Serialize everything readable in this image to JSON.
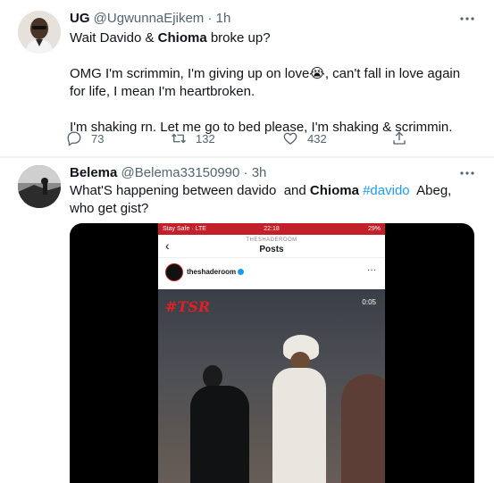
{
  "tweets": [
    {
      "name": "UG",
      "handle": "@UgwunnaEjikem",
      "separator": "·",
      "time": "1h",
      "body": {
        "line1_pre": "Wait Davido & ",
        "line1_bold": "Chioma",
        "line1_post": " broke up?",
        "para2": "OMG I'm scrimmin, I'm giving up on love😭, can't fall in love again for life, I mean I'm heartbroken.",
        "para3": "I'm shaking rn. Let me go to bed please, I'm shaking & scrimmin."
      },
      "actions": {
        "reply_count": "73",
        "retweet_count": "132",
        "like_count": "432"
      }
    },
    {
      "name": "Belema",
      "handle": "@Belema33150990",
      "separator": "·",
      "time": "3h",
      "body": {
        "pre": "What'S happening between davido  and ",
        "bold": "Chioma",
        "hashtag": "#davido",
        "post": "  Abeg, who get gist?"
      },
      "media": {
        "status_left": "Stay Safe · LTE",
        "status_time": "22:18",
        "status_right": "29%",
        "ig_account": "THESHADEROOM",
        "ig_title": "Posts",
        "ig_username": "theshaderoom",
        "video_watermark": "#TSR",
        "video_time": "0:05"
      }
    }
  ],
  "icons": {
    "more": "more-horizontal-icon",
    "reply": "reply-icon",
    "retweet": "retweet-icon",
    "like": "heart-icon",
    "share": "share-icon"
  },
  "colors": {
    "text": "#0f1419",
    "secondary": "#536471",
    "link": "#1d9bf0",
    "divider": "#eff3f4",
    "tsr_red": "#e21f26"
  }
}
